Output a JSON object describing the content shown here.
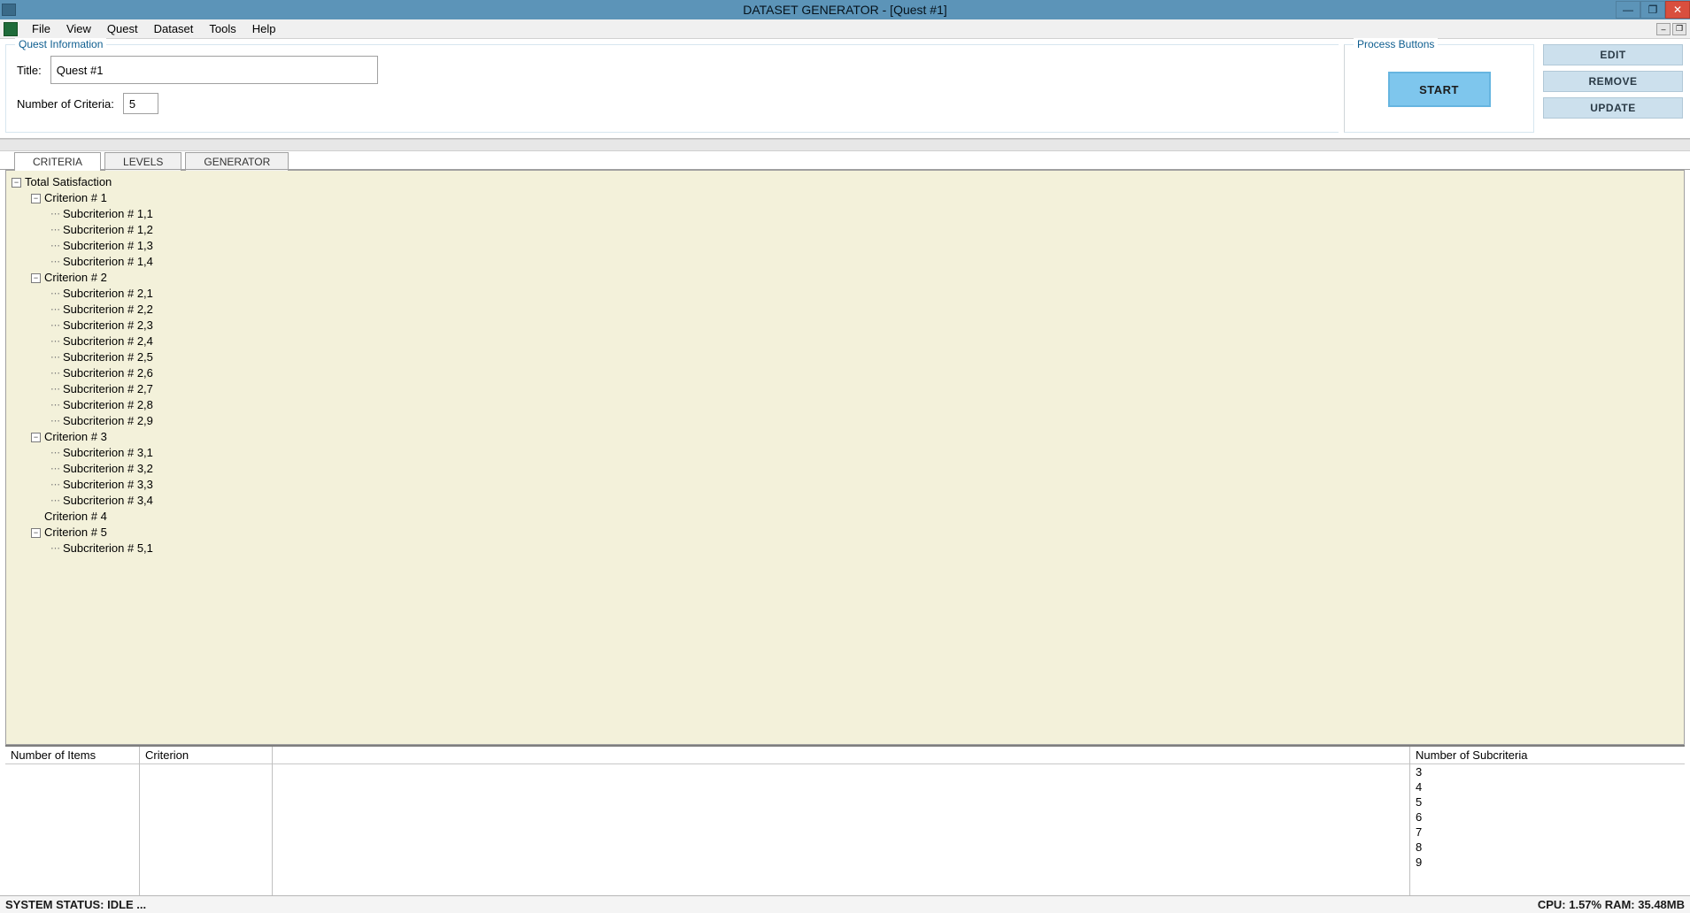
{
  "window": {
    "title": "DATASET GENERATOR - [Quest #1]"
  },
  "menu": {
    "file": "File",
    "view": "View",
    "quest": "Quest",
    "dataset": "Dataset",
    "tools": "Tools",
    "help": "Help"
  },
  "questInfo": {
    "legend": "Quest Information",
    "titleLabel": "Title:",
    "titleValue": "Quest #1",
    "numCriteriaLabel": "Number of Criteria:",
    "numCriteriaValue": "5"
  },
  "process": {
    "legend": "Process Buttons",
    "start": "START"
  },
  "rightButtons": {
    "edit": "EDIT",
    "remove": "REMOVE",
    "update": "UPDATE"
  },
  "tabs": {
    "criteria": "CRITERIA",
    "levels": "LEVELS",
    "generator": "GENERATOR"
  },
  "tree": {
    "root": "Total Satisfaction",
    "criteria": [
      {
        "label": "Criterion # 1",
        "expanded": true,
        "subs": [
          "Subcriterion # 1,1",
          "Subcriterion # 1,2",
          "Subcriterion # 1,3",
          "Subcriterion # 1,4"
        ]
      },
      {
        "label": "Criterion # 2",
        "expanded": true,
        "subs": [
          "Subcriterion # 2,1",
          "Subcriterion # 2,2",
          "Subcriterion # 2,3",
          "Subcriterion # 2,4",
          "Subcriterion # 2,5",
          "Subcriterion # 2,6",
          "Subcriterion # 2,7",
          "Subcriterion # 2,8",
          "Subcriterion # 2,9"
        ]
      },
      {
        "label": "Criterion # 3",
        "expanded": true,
        "subs": [
          "Subcriterion # 3,1",
          "Subcriterion # 3,2",
          "Subcriterion # 3,3",
          "Subcriterion # 3,4"
        ]
      },
      {
        "label": "Criterion # 4",
        "expanded": false,
        "subs": []
      },
      {
        "label": "Criterion # 5",
        "expanded": true,
        "subs": [
          "Subcriterion # 5,1"
        ]
      }
    ]
  },
  "lower": {
    "headers": {
      "items": "Number of Items",
      "criterion": "Criterion",
      "subcount": "Number of Subcriteria"
    },
    "subcounts": [
      "3",
      "4",
      "5",
      "6",
      "7",
      "8",
      "9"
    ]
  },
  "status": {
    "left": "SYSTEM STATUS: IDLE ...",
    "right": "CPU: 1.57% RAM: 35.48MB"
  }
}
